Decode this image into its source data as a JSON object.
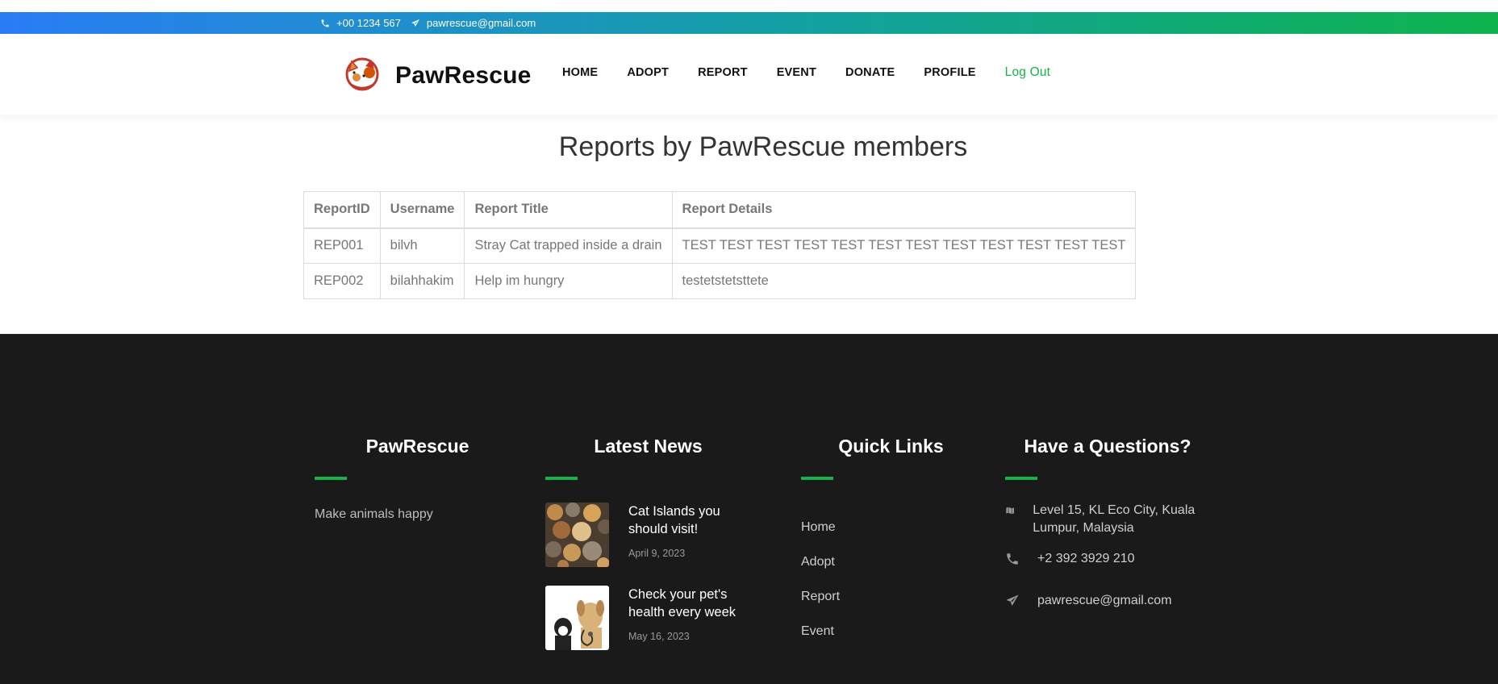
{
  "topbar": {
    "phone": "+00 1234 567",
    "email": "pawrescue@gmail.com",
    "phone_icon": "phone-icon",
    "email_icon": "paper-plane-icon"
  },
  "brand": {
    "name": "PawRescue",
    "logo_icon": "cat-dog-logo"
  },
  "nav": {
    "home": "HOME",
    "adopt": "ADOPT",
    "report": "REPORT",
    "event": "EVENT",
    "donate": "DONATE",
    "profile": "PROFILE",
    "logout": "Log Out"
  },
  "page": {
    "title": "Reports by PawRescue members"
  },
  "table": {
    "headers": [
      "ReportID",
      "Username",
      "Report Title",
      "Report Details"
    ],
    "rows": [
      [
        "REP001",
        "bilvh",
        "Stray Cat trapped inside a drain",
        "TEST TEST TEST TEST TEST TEST TEST TEST TEST TEST TEST TEST"
      ],
      [
        "REP002",
        "bilahhakim",
        "Help im hungry",
        "testetstetsttete"
      ]
    ]
  },
  "footer": {
    "about": {
      "heading": "PawRescue",
      "tagline": "Make animals happy"
    },
    "news": {
      "heading": "Latest News",
      "items": [
        {
          "title": "Cat Islands you should visit!",
          "date": "April 9, 2023"
        },
        {
          "title": "Check your pet's health every week",
          "date": "May 16, 2023"
        }
      ]
    },
    "links": {
      "heading": "Quick Links",
      "items": [
        "Home",
        "Adopt",
        "Report",
        "Event"
      ]
    },
    "contact": {
      "heading": "Have a Questions?",
      "address": "Level 15, KL Eco City, Kuala Lumpur, Malaysia",
      "phone": "+2 392 3929 210",
      "email": "pawrescue@gmail.com"
    }
  },
  "colors": {
    "accent": "#16b24a",
    "footer_bg": "#1a1a1a",
    "gradient_start": "#2a7cf6",
    "gradient_end": "#0fb44e"
  }
}
